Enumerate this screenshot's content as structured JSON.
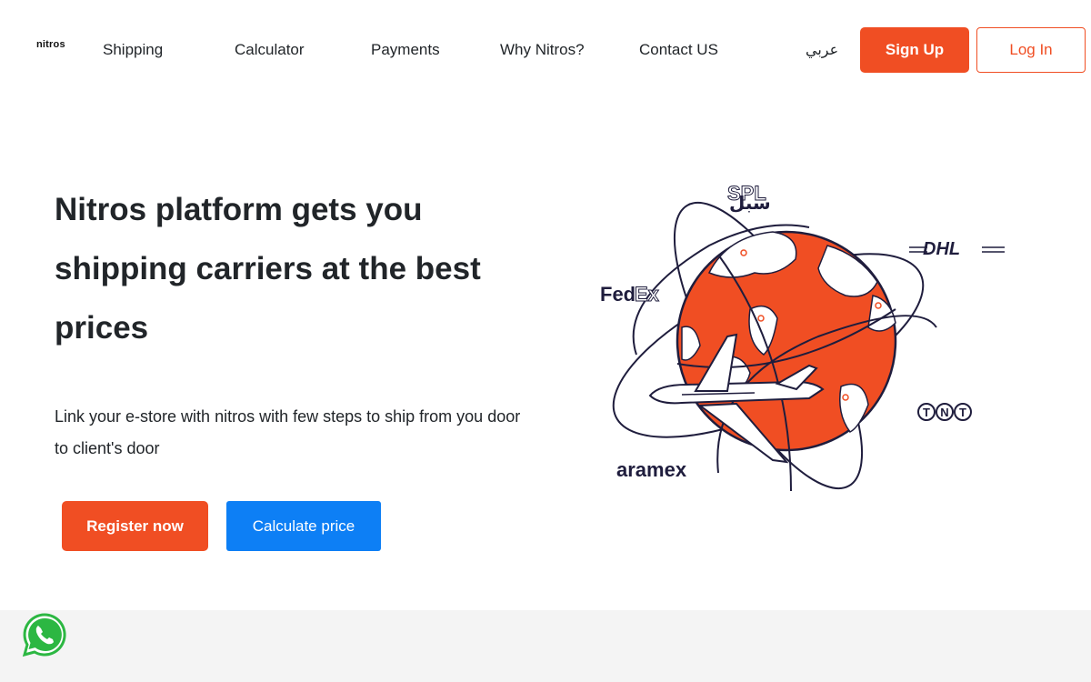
{
  "brand": {
    "logo_text": "nitros",
    "accent": "#f04e23",
    "blue": "#0d7ff5"
  },
  "nav": {
    "links": [
      "Shipping",
      "Calculator",
      "Payments",
      "Why Nitros?",
      "Contact US"
    ],
    "language": "عربي",
    "signup_label": "Sign Up",
    "login_label": "Log In"
  },
  "hero": {
    "title": "Nitros platform gets you shipping carriers at the best prices",
    "subtitle": "Link your e-store with nitros with few steps to ship from you door to client's door",
    "register_label": "Register now",
    "calculate_label": "Calculate price"
  },
  "carriers": {
    "spl": "SPL",
    "spl_arabic": "سبل",
    "dhl": "DHL",
    "fedex_fed": "Fed",
    "fedex_ex": "Ex",
    "tnt": [
      "T",
      "N",
      "T"
    ],
    "aramex": "aramex"
  },
  "icons": {
    "whatsapp": "whatsapp-icon",
    "globe": "globe-illustration",
    "plane": "airplane-icon"
  }
}
